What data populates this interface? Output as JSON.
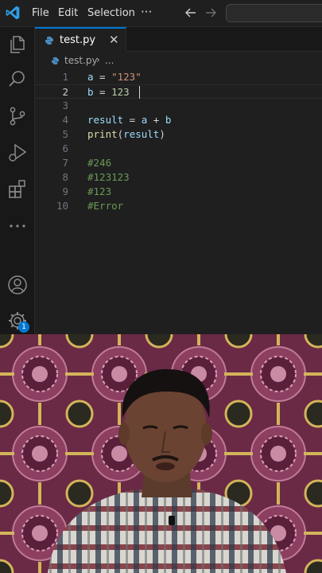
{
  "titlebar": {
    "menus": [
      "File",
      "Edit",
      "Selection"
    ],
    "more": "···"
  },
  "tab": {
    "label": "test.py",
    "close": "✕"
  },
  "breadcrumb": {
    "file": "test.py",
    "separator": "›",
    "more": "..."
  },
  "editor": {
    "lines": [
      {
        "num": "1",
        "tokens": [
          {
            "t": "a",
            "c": "var"
          },
          {
            "t": " = ",
            "c": "op"
          },
          {
            "t": "\"123\"",
            "c": "str"
          }
        ]
      },
      {
        "num": "2",
        "tokens": [
          {
            "t": "b",
            "c": "var"
          },
          {
            "t": " = ",
            "c": "op"
          },
          {
            "t": "123",
            "c": "num"
          }
        ]
      },
      {
        "num": "3",
        "tokens": []
      },
      {
        "num": "4",
        "tokens": [
          {
            "t": "result",
            "c": "var"
          },
          {
            "t": " = ",
            "c": "op"
          },
          {
            "t": "a",
            "c": "var"
          },
          {
            "t": " + ",
            "c": "op"
          },
          {
            "t": "b",
            "c": "var"
          }
        ]
      },
      {
        "num": "5",
        "tokens": [
          {
            "t": "print",
            "c": "fn"
          },
          {
            "t": "(",
            "c": "op"
          },
          {
            "t": "result",
            "c": "var"
          },
          {
            "t": ")",
            "c": "op"
          }
        ]
      },
      {
        "num": "6",
        "tokens": []
      },
      {
        "num": "7",
        "tokens": [
          {
            "t": "#246",
            "c": "com"
          }
        ]
      },
      {
        "num": "8",
        "tokens": [
          {
            "t": "#123123",
            "c": "com"
          }
        ]
      },
      {
        "num": "9",
        "tokens": [
          {
            "t": "#123",
            "c": "com"
          }
        ]
      },
      {
        "num": "10",
        "tokens": [
          {
            "t": "#Error",
            "c": "com"
          }
        ]
      }
    ],
    "active_line": 2
  },
  "activity": {
    "icons": [
      "explorer-icon",
      "search-icon",
      "source-control-icon",
      "run-debug-icon",
      "extensions-icon",
      "more-icon",
      "account-icon",
      "manage-gear-icon"
    ],
    "settings_badge": "1"
  },
  "colors": {
    "accent": "#0078d4",
    "python_icon": "#4b8bbe",
    "editor_bg": "#1f1f1f",
    "string": "#ce9178",
    "number": "#b5cea8",
    "comment": "#6a9955",
    "function": "#dcdcaa",
    "variable": "#9cdcfe"
  }
}
